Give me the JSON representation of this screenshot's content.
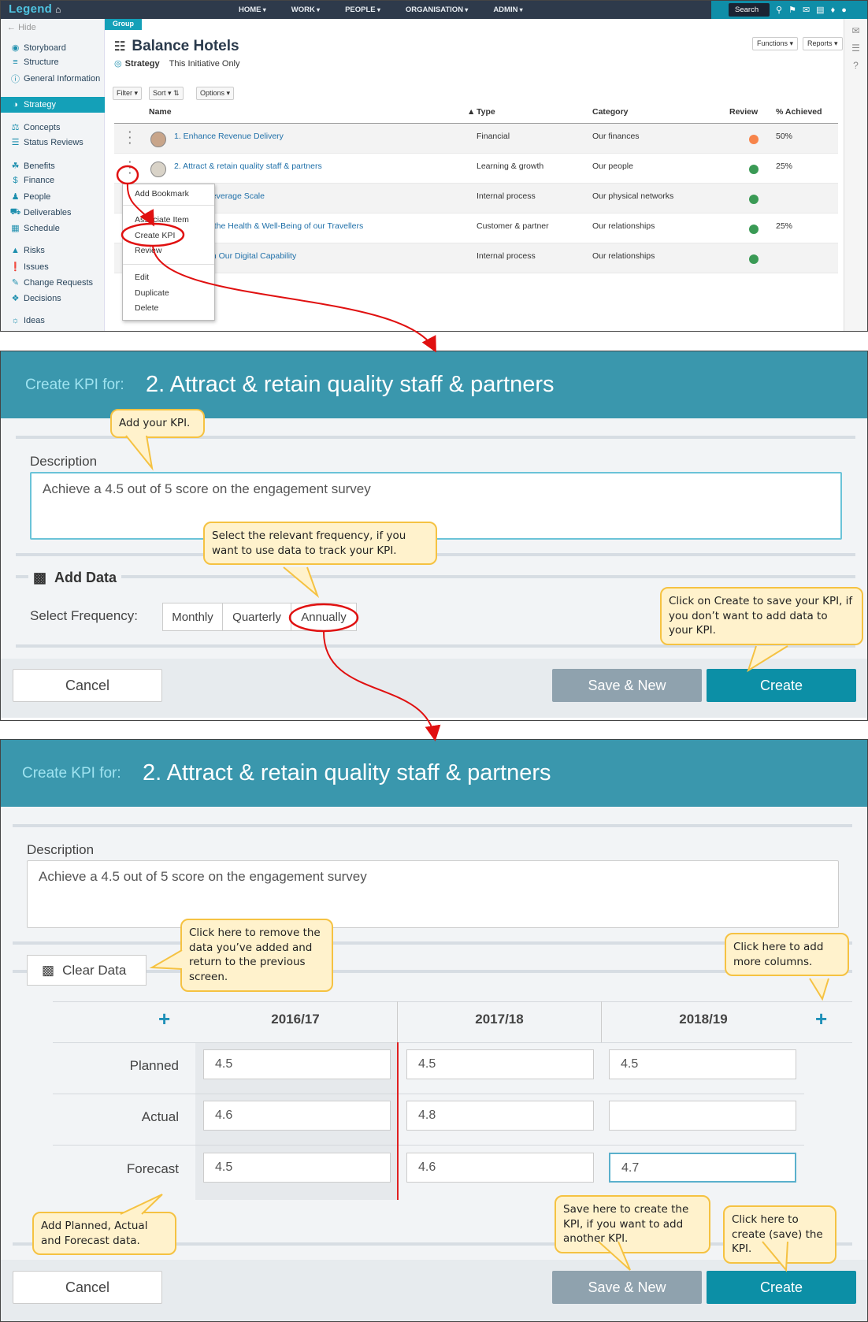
{
  "app": {
    "logo": "Legend",
    "nav": [
      "HOME",
      "WORK",
      "PEOPLE",
      "ORGANISATION",
      "ADMIN"
    ],
    "search_label": "Search"
  },
  "sidebar": {
    "hide": "Hide",
    "items": [
      {
        "label": "Storyboard",
        "icon": "palette-icon"
      },
      {
        "label": "Structure",
        "icon": "structure-icon"
      },
      {
        "label": "General Information",
        "icon": "info-icon"
      },
      {
        "label": "Strategy",
        "icon": "compass-icon"
      },
      {
        "label": "Concepts",
        "icon": "scales-icon"
      },
      {
        "label": "Status Reviews",
        "icon": "list-icon"
      },
      {
        "label": "Benefits",
        "icon": "ribbon-icon"
      },
      {
        "label": "Finance",
        "icon": "dollar-icon"
      },
      {
        "label": "People",
        "icon": "people-icon"
      },
      {
        "label": "Deliverables",
        "icon": "truck-icon"
      },
      {
        "label": "Schedule",
        "icon": "schedule-icon"
      },
      {
        "label": "Risks",
        "icon": "warning-icon"
      },
      {
        "label": "Issues",
        "icon": "alert-icon"
      },
      {
        "label": "Change Requests",
        "icon": "edit-icon"
      },
      {
        "label": "Decisions",
        "icon": "sitemap-icon"
      },
      {
        "label": "Ideas",
        "icon": "lightbulb-icon"
      }
    ]
  },
  "page": {
    "group_tag": "Group",
    "title": "Balance Hotels",
    "subtitle": "Strategy",
    "scope": "This Initiative Only",
    "functions": "Functions",
    "reports": "Reports",
    "filter": "Filter",
    "sort": "Sort",
    "options": "Options"
  },
  "table": {
    "headers": {
      "name": "Name",
      "type": "Type",
      "category": "Category",
      "review": "Review",
      "achieved": "% Achieved"
    },
    "rows": [
      {
        "name": "1. Enhance Revenue Delivery",
        "type": "Financial",
        "category": "Our finances",
        "review": "orange",
        "achieved": "50%"
      },
      {
        "name": "2. Attract & retain quality staff & partners",
        "type": "Learning & growth",
        "category": "Our people",
        "review": "green",
        "achieved": "25%"
      },
      {
        "name": "Leverage Scale",
        "type": "Internal process",
        "category": "Our physical networks",
        "review": "green",
        "achieved": ""
      },
      {
        "name": "e the Health & Well-Being of our Travellers",
        "type": "Customer & partner",
        "category": "Our relationships",
        "review": "green",
        "achieved": "25%"
      },
      {
        "name": "en Our Digital Capability",
        "type": "Internal process",
        "category": "Our relationships",
        "review": "green",
        "achieved": ""
      }
    ]
  },
  "context_menu": [
    "Add Bookmark",
    "Associate Item",
    "Create KPI",
    "Review",
    "Edit",
    "Duplicate",
    "Delete"
  ],
  "dialog": {
    "prefix": "Create KPI for:",
    "title": "2. Attract & retain quality staff & partners",
    "description_label": "Description",
    "description_value": "Achieve a 4.5 out of 5 score on the engagement survey",
    "add_data": "Add Data",
    "select_frequency": "Select Frequency:",
    "frequencies": [
      "Monthly",
      "Quarterly",
      "Annually"
    ],
    "cancel": "Cancel",
    "save_new": "Save & New",
    "create": "Create",
    "clear_data": "Clear Data"
  },
  "kpi_grid": {
    "columns": [
      "2016/17",
      "2017/18",
      "2018/19"
    ],
    "rows": [
      {
        "label": "Planned",
        "values": [
          "4.5",
          "4.5",
          "4.5"
        ]
      },
      {
        "label": "Actual",
        "values": [
          "4.6",
          "4.8",
          ""
        ]
      },
      {
        "label": "Forecast",
        "values": [
          "4.5",
          "4.6",
          "4.7"
        ]
      }
    ]
  },
  "callouts": {
    "add_kpi": "Add your KPI.",
    "frequency": "Select the relevant frequency, if you want to use data to track your KPI.",
    "create_save": "Click on Create to save your KPI, if you don’t want to add data to your KPI.",
    "clear_data": "Click here to remove the data you’ve added and return to the previous screen.",
    "add_columns": "Click here to add more columns.",
    "add_data": "Add Planned, Actual and Forecast data.",
    "save_new": "Save here to create the KPI, if you want to add another KPI.",
    "create": "Click here to create (save) the KPI."
  },
  "colors": {
    "accent": "#14a0b8",
    "header": "#3a97ad",
    "callout_fill": "#fff2cc",
    "callout_border": "#f5c242",
    "annotation": "#e01010"
  }
}
